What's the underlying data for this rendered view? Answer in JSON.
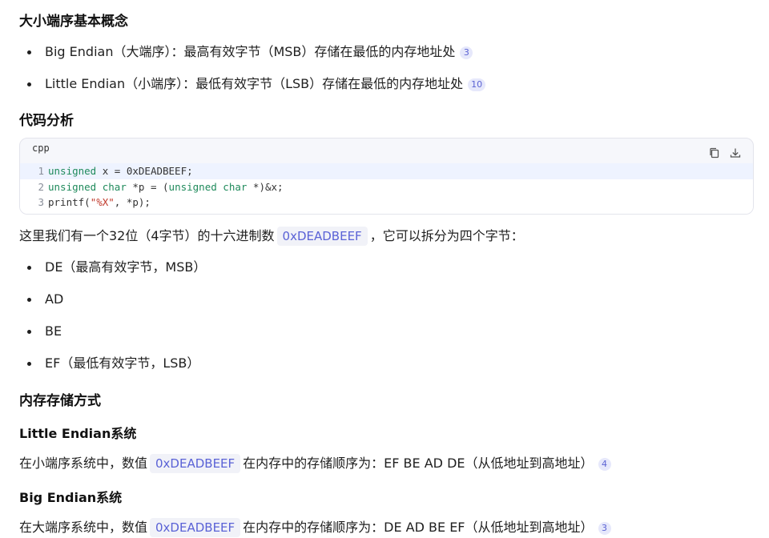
{
  "sections": {
    "concepts_title": "大小端序基本概念",
    "code_title": "代码分析",
    "memory_title": "内存存储方式",
    "little_sys_title": "Little Endian系统",
    "big_sys_title": "Big Endian系统"
  },
  "concepts": [
    {
      "text": "Big Endian（大端序）：最高有效字节（MSB）存储在最低的内存地址处",
      "cite": "3"
    },
    {
      "text": "Little Endian（小端序）：最低有效字节（LSB）存储在最低的内存地址处",
      "cite": "10"
    }
  ],
  "code_block": {
    "language": "cpp",
    "lines": [
      {
        "num": "1",
        "parts": [
          [
            "kw",
            "unsigned"
          ],
          [
            "t",
            " x = 0xDEADBEEF;"
          ]
        ]
      },
      {
        "num": "2",
        "parts": [
          [
            "kw",
            "unsigned"
          ],
          [
            "t",
            " "
          ],
          [
            "kw",
            "char"
          ],
          [
            "t",
            " *p = ("
          ],
          [
            "kw",
            "unsigned"
          ],
          [
            "t",
            " "
          ],
          [
            "kw",
            "char"
          ],
          [
            "t",
            " *)&x;"
          ]
        ]
      },
      {
        "num": "3",
        "parts": [
          [
            "t",
            "printf("
          ],
          [
            "str",
            "\"%X\""
          ],
          [
            "t",
            ", *p);"
          ]
        ]
      }
    ]
  },
  "explain": {
    "before": "这里我们有一个32位（4字节）的十六进制数",
    "code": "0xDEADBEEF",
    "after": "，它可以拆分为四个字节："
  },
  "bytes": [
    "DE（最高有效字节，MSB）",
    "AD",
    "BE",
    "EF（最低有效字节，LSB）"
  ],
  "little_para": {
    "before": "在小端序系统中，数值",
    "code": "0xDEADBEEF",
    "after": "在内存中的存储顺序为：EF BE AD DE（从低地址到高地址）",
    "cite": "4"
  },
  "big_para": {
    "before": "在大端序系统中，数值",
    "code": "0xDEADBEEF",
    "after": "在内存中的存储顺序为：DE AD BE EF（从低地址到高地址）",
    "cite": "3"
  },
  "icons": {
    "copy": "copy-icon",
    "download": "download-icon"
  },
  "colors": {
    "keyword": "#1f8a5b",
    "string": "#c0392b",
    "inline_code": "#5a62d6",
    "citation": "#5b63d3"
  }
}
